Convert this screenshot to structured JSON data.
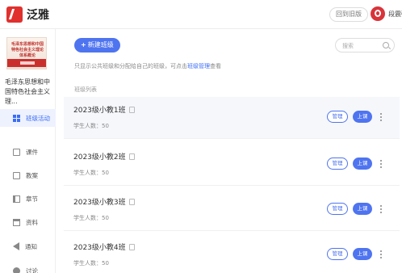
{
  "app": {
    "logo_text": "泛雅",
    "back_label": "回到旧版",
    "username": "段震强"
  },
  "course": {
    "cover_text": "毛泽东思想和中国特色社会主义理论体系概论",
    "title": "毛泽东思想和中国特色社会主义理..."
  },
  "sidebar": {
    "items": [
      {
        "label": "班级活动",
        "icon": "grid-icon",
        "active": true
      },
      {
        "label": "课件",
        "icon": "document-icon"
      },
      {
        "label": "教案",
        "icon": "document-icon"
      },
      {
        "label": "章节",
        "icon": "book-icon"
      },
      {
        "label": "资料",
        "icon": "folder-icon"
      },
      {
        "label": "通知",
        "icon": "megaphone-icon"
      },
      {
        "label": "讨论",
        "icon": "chat-icon"
      }
    ]
  },
  "main": {
    "new_class_label": "新建班级",
    "search_placeholder": "搜索",
    "hint_prefix": "只显示公共班级和分配给自己的班级，可点击",
    "hint_link": "班级管理",
    "hint_suffix": "查看",
    "list_label": "班级列表",
    "manage_label": "管理",
    "class_label": "上课",
    "classes": [
      {
        "name": "2023级小教1班",
        "students": "学生人数：50"
      },
      {
        "name": "2023级小教2班",
        "students": "学生人数：50"
      },
      {
        "name": "2023级小教3班",
        "students": "学生人数：50"
      },
      {
        "name": "2023级小教4班",
        "students": "学生人数：50"
      }
    ]
  },
  "colors": {
    "accent": "#4f74f0",
    "brand": "#e0312f"
  }
}
